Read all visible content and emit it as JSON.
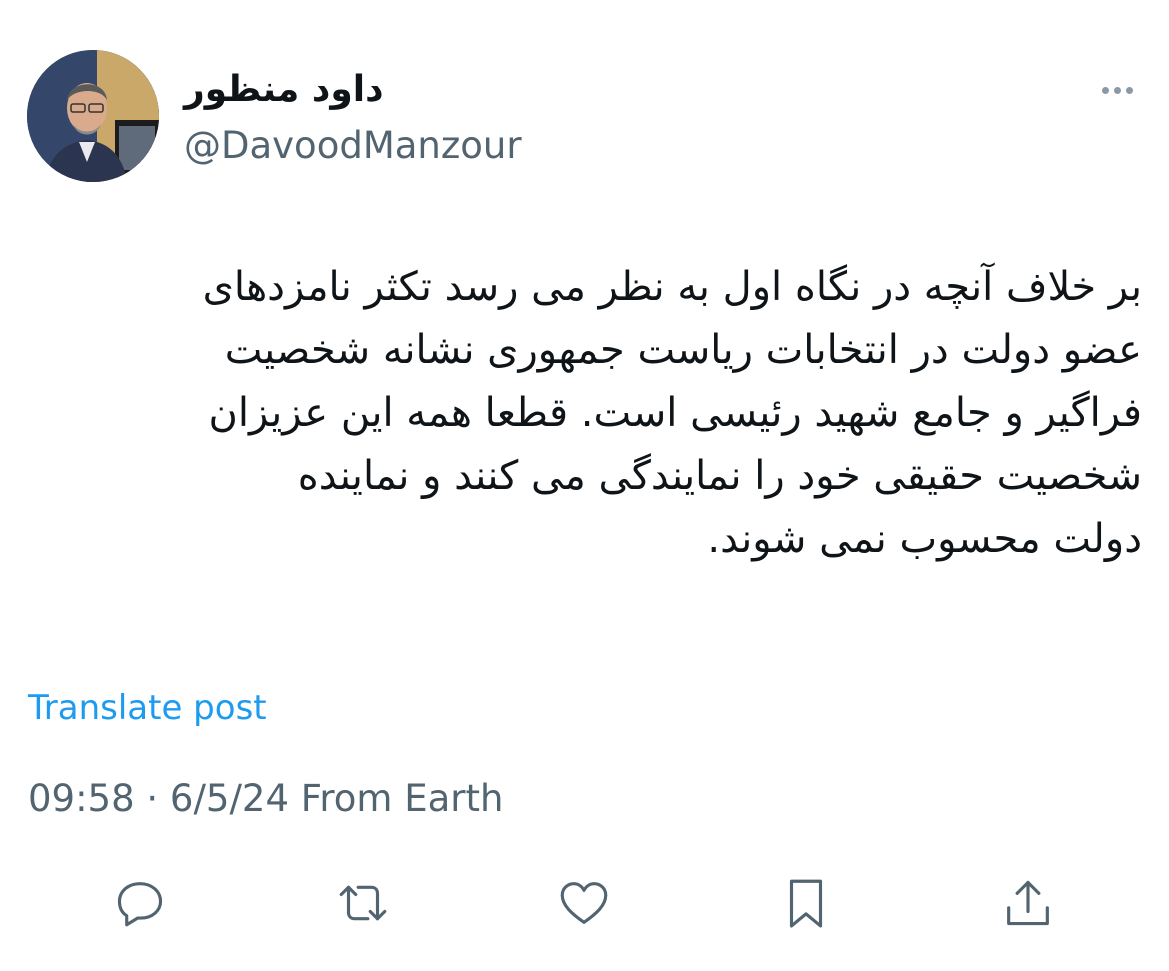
{
  "post": {
    "author": {
      "display_name": "داود منظور",
      "handle": "@DavoodManzour",
      "avatar_icon": "user-avatar"
    },
    "text": "بر خلاف آنچه در نگاه اول به نظر می رسد تکثر نامزدهای\nعضو دولت در انتخابات ریاست جمهوری نشانه شخصیت\nفراگیر و جامع شهید رئیسی است. قطعا همه این عزیزان\nشخصیت حقیقی خود را نمایندگی می کنند و نماینده\nدولت محسوب نمی شوند.",
    "translate_label": "Translate post",
    "meta": "09:58 · 6/5/24 From Earth",
    "more_icon": "more-dots-icon",
    "actions": [
      {
        "name": "reply",
        "icon": "reply-icon"
      },
      {
        "name": "repost",
        "icon": "repost-icon"
      },
      {
        "name": "like",
        "icon": "heart-icon"
      },
      {
        "name": "bookmark",
        "icon": "bookmark-icon"
      },
      {
        "name": "share",
        "icon": "share-icon"
      }
    ]
  },
  "colors": {
    "text": "#0f1419",
    "secondary": "#536471",
    "link": "#1d9bf0",
    "background": "#ffffff"
  }
}
